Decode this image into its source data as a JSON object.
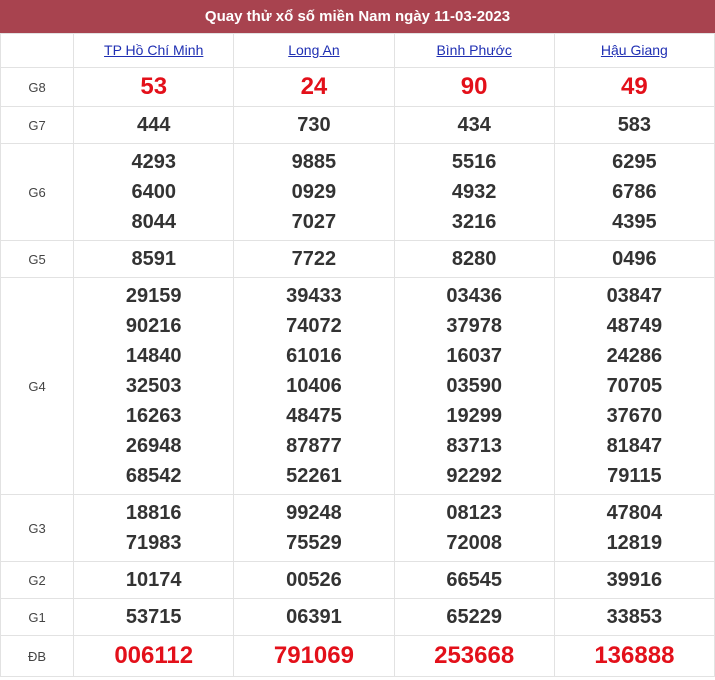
{
  "title": "Quay thử xổ số miền Nam ngày 11-03-2023",
  "provinces": [
    "TP Hồ Chí Minh",
    "Long An",
    "Bình Phước",
    "Hậu Giang"
  ],
  "prizes": [
    {
      "label": "G8",
      "key": "g8",
      "highlight": true,
      "values": [
        [
          "53"
        ],
        [
          "24"
        ],
        [
          "90"
        ],
        [
          "49"
        ]
      ]
    },
    {
      "label": "G7",
      "key": "g7",
      "highlight": false,
      "values": [
        [
          "444"
        ],
        [
          "730"
        ],
        [
          "434"
        ],
        [
          "583"
        ]
      ]
    },
    {
      "label": "G6",
      "key": "g6",
      "highlight": false,
      "values": [
        [
          "4293",
          "6400",
          "8044"
        ],
        [
          "9885",
          "0929",
          "7027"
        ],
        [
          "5516",
          "4932",
          "3216"
        ],
        [
          "6295",
          "6786",
          "4395"
        ]
      ]
    },
    {
      "label": "G5",
      "key": "g5",
      "highlight": false,
      "values": [
        [
          "8591"
        ],
        [
          "7722"
        ],
        [
          "8280"
        ],
        [
          "0496"
        ]
      ]
    },
    {
      "label": "G4",
      "key": "g4",
      "highlight": false,
      "values": [
        [
          "29159",
          "90216",
          "14840",
          "32503",
          "16263",
          "26948",
          "68542"
        ],
        [
          "39433",
          "74072",
          "61016",
          "10406",
          "48475",
          "87877",
          "52261"
        ],
        [
          "03436",
          "37978",
          "16037",
          "03590",
          "19299",
          "83713",
          "92292"
        ],
        [
          "03847",
          "48749",
          "24286",
          "70705",
          "37670",
          "81847",
          "79115"
        ]
      ]
    },
    {
      "label": "G3",
      "key": "g3",
      "highlight": false,
      "values": [
        [
          "18816",
          "71983"
        ],
        [
          "99248",
          "75529"
        ],
        [
          "08123",
          "72008"
        ],
        [
          "47804",
          "12819"
        ]
      ]
    },
    {
      "label": "G2",
      "key": "g2",
      "highlight": false,
      "values": [
        [
          "10174"
        ],
        [
          "00526"
        ],
        [
          "66545"
        ],
        [
          "39916"
        ]
      ]
    },
    {
      "label": "G1",
      "key": "g1",
      "highlight": false,
      "values": [
        [
          "53715"
        ],
        [
          "06391"
        ],
        [
          "65229"
        ],
        [
          "33853"
        ]
      ]
    },
    {
      "label": "ĐB",
      "key": "db",
      "highlight": true,
      "values": [
        [
          "006112"
        ],
        [
          "791069"
        ],
        [
          "253668"
        ],
        [
          "136888"
        ]
      ]
    }
  ],
  "colors": {
    "title_bg": "#a8434f",
    "highlight": "#e3101a",
    "link": "#1f2fb3"
  }
}
